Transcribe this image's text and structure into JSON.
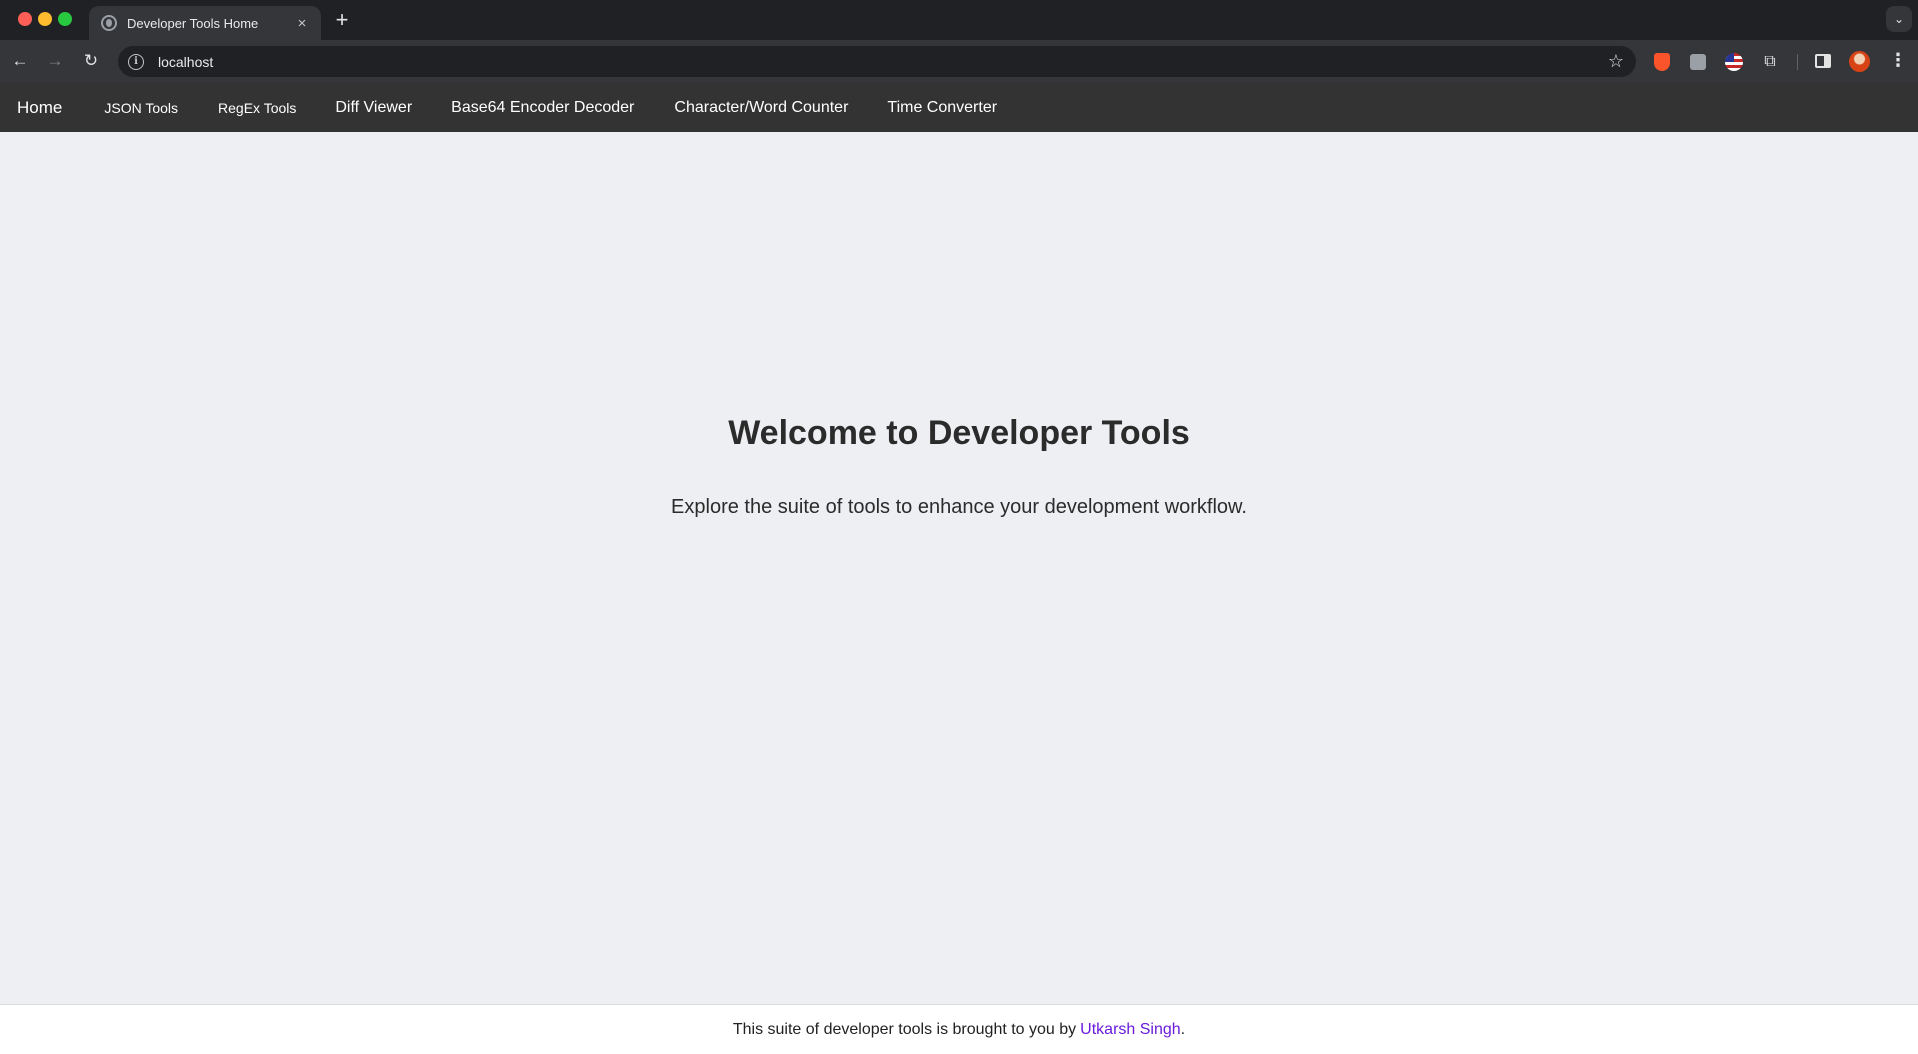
{
  "browser": {
    "tab_title": "Developer Tools Home",
    "tab_close": "×",
    "new_tab": "+",
    "tab_search": "⌄",
    "url": "localhost",
    "icons": {
      "back": "←",
      "forward": "→",
      "reload": "↻",
      "info": "i",
      "star": "☆",
      "puzzle": "⧉",
      "menu": "⋮"
    }
  },
  "nav": {
    "items": [
      {
        "label": "Home"
      },
      {
        "label": "JSON Tools"
      },
      {
        "label": "RegEx Tools"
      },
      {
        "label": "Diff Viewer"
      },
      {
        "label": "Base64 Encoder Decoder"
      },
      {
        "label": "Character/Word Counter"
      },
      {
        "label": "Time Converter"
      }
    ]
  },
  "main": {
    "heading": "Welcome to Developer Tools",
    "subtitle": "Explore the suite of tools to enhance your development workflow."
  },
  "footer": {
    "text_before": "This suite of developer tools is brought to you by",
    "author_link": "Utkarsh Singh",
    "text_after": "."
  },
  "colors": {
    "nav_background": "#333333",
    "page_background": "#eeeff3",
    "link": "#6a1bdb"
  }
}
